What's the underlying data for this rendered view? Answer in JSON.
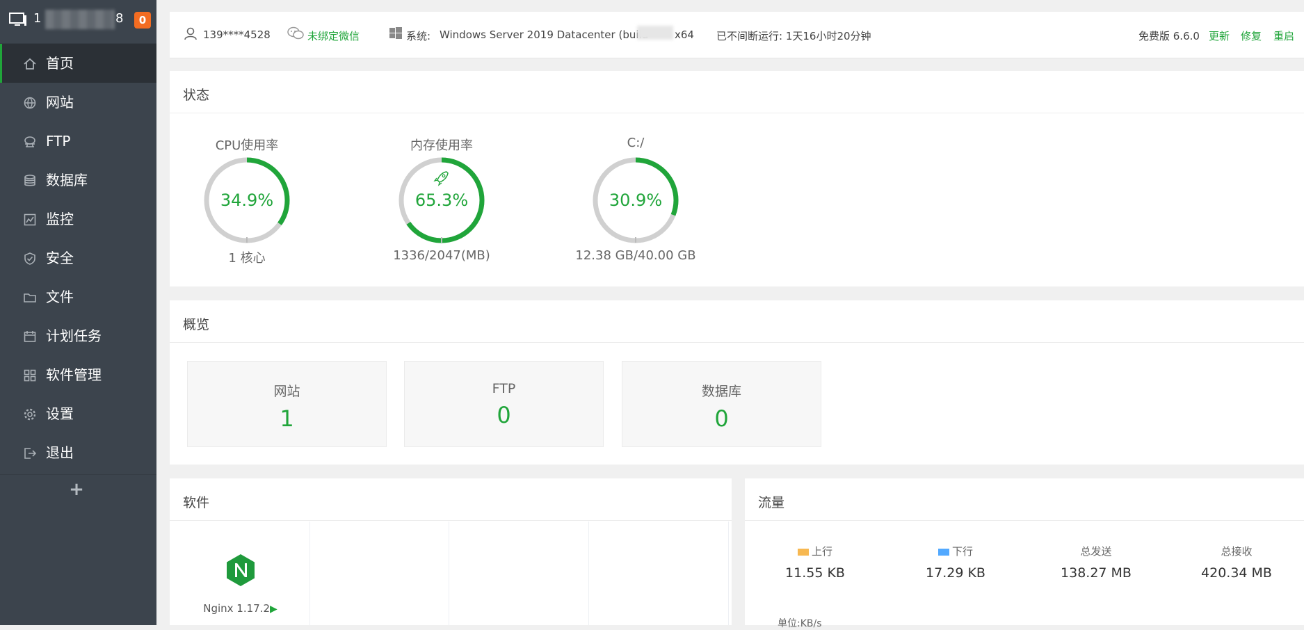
{
  "sidebar": {
    "host_prefix": "1",
    "host_suffix": "8",
    "badge": "0",
    "items": [
      {
        "label": "首页"
      },
      {
        "label": "网站"
      },
      {
        "label": "FTP"
      },
      {
        "label": "数据库"
      },
      {
        "label": "监控"
      },
      {
        "label": "安全"
      },
      {
        "label": "文件"
      },
      {
        "label": "计划任务"
      },
      {
        "label": "软件管理"
      },
      {
        "label": "设置"
      },
      {
        "label": "退出"
      }
    ],
    "add_label": "+"
  },
  "topbar": {
    "user": "139****4528",
    "wechat": "未绑定微信",
    "system_label": "系统:",
    "system_value": "Windows Server 2019 Datacenter (build",
    "system_tail": "x64",
    "uptime": "已不间断运行: 1天16小时20分钟",
    "version": "免费版 6.6.0",
    "update": "更新",
    "repair": "修复",
    "restart": "重启"
  },
  "status": {
    "title": "状态",
    "gauges": [
      {
        "label": "CPU使用率",
        "value": "34.9%",
        "percent": 34.9,
        "sub": "1 核心"
      },
      {
        "label": "内存使用率",
        "value": "65.3%",
        "percent": 65.3,
        "sub": "1336/2047(MB)"
      },
      {
        "label": "C:/",
        "value": "30.9%",
        "percent": 30.9,
        "sub": "12.38 GB/40.00 GB"
      }
    ]
  },
  "overview": {
    "title": "概览",
    "boxes": [
      {
        "label": "网站",
        "value": "1"
      },
      {
        "label": "FTP",
        "value": "0"
      },
      {
        "label": "数据库",
        "value": "0"
      }
    ]
  },
  "software": {
    "title": "软件",
    "items": [
      {
        "name": "Nginx 1.17.2"
      }
    ]
  },
  "traffic": {
    "title": "流量",
    "up_label": "上行",
    "up_value": "11.55 KB",
    "down_label": "下行",
    "down_value": "17.29 KB",
    "sent_label": "总发送",
    "sent_value": "138.27 MB",
    "recv_label": "总接收",
    "recv_value": "420.34 MB",
    "unit": "单位:KB/s",
    "up_color": "#f7b851",
    "down_color": "#52a9ff"
  },
  "colors": {
    "accent": "#20a53a",
    "sidebar": "#3c444d",
    "badge": "#f36c21"
  }
}
